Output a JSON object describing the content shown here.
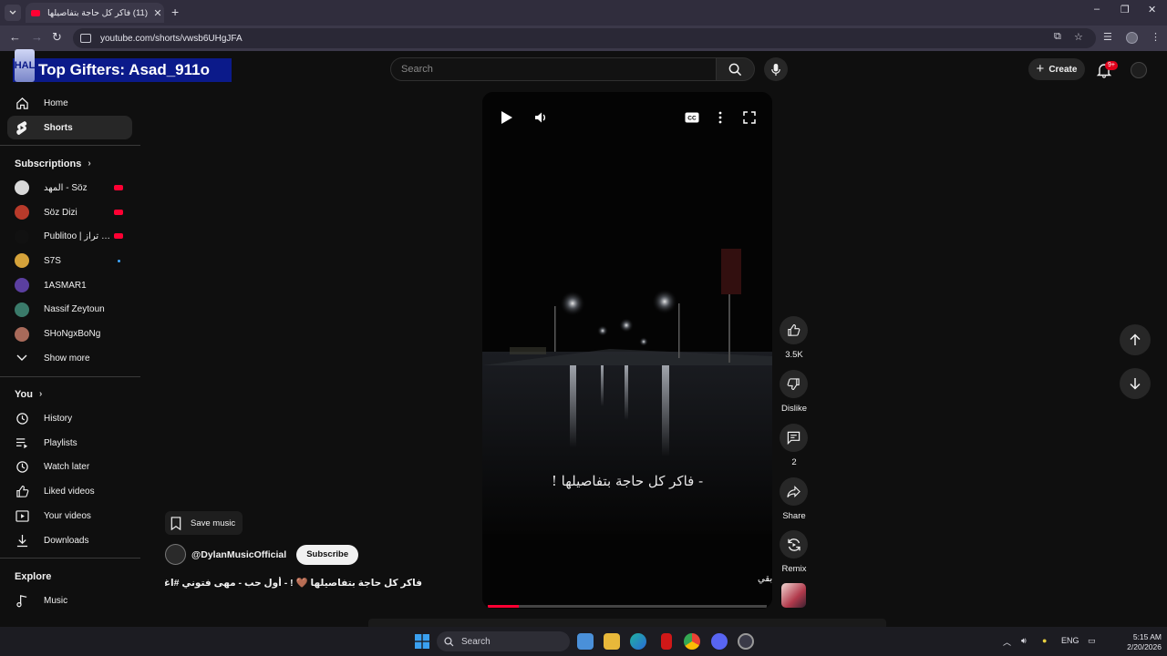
{
  "browser": {
    "tab_title": "(11) فاكر كل حاجة بتفاصيلها 🤎 !",
    "tab_close": "✕",
    "new_tab": "+",
    "url": "youtube.com/shorts/vwsb6UHgJFA",
    "window_controls": [
      "–",
      "❐",
      "✕"
    ]
  },
  "overlay": {
    "logo_text": "HAL",
    "banner_text": "Top Gifters: Asad_911o"
  },
  "header": {
    "search_placeholder": "Search",
    "create_label": "Create",
    "notification_badge": "9+"
  },
  "sidebar": {
    "main": [
      {
        "label": "Home",
        "icon": "home-icon"
      },
      {
        "label": "Shorts",
        "icon": "shorts-icon",
        "active": true
      }
    ],
    "subscriptions_heading": "Subscriptions",
    "subscriptions": [
      {
        "name": "المهد - Söz",
        "color": "#d9d9d9",
        "indicator": "live"
      },
      {
        "name": "Söz Dizi",
        "color": "#b83a2a",
        "indicator": "live"
      },
      {
        "name": "Publitoo | ديلي تراز",
        "color": "#111111",
        "indicator": "live"
      },
      {
        "name": "S7S",
        "color": "#d4a23a",
        "indicator": "new"
      },
      {
        "name": "1ASMAR1",
        "color": "#5b3fa0",
        "indicator": ""
      },
      {
        "name": "Nassif Zeytoun",
        "color": "#3a7a6a",
        "indicator": ""
      },
      {
        "name": "SHoNgxBoNg",
        "color": "#a86a5a",
        "indicator": ""
      }
    ],
    "show_more": "Show more",
    "you_heading": "You",
    "you_items": [
      {
        "label": "History",
        "icon": "history-icon"
      },
      {
        "label": "Playlists",
        "icon": "playlists-icon"
      },
      {
        "label": "Watch later",
        "icon": "watch-later-icon"
      },
      {
        "label": "Liked videos",
        "icon": "liked-videos-icon"
      },
      {
        "label": "Your videos",
        "icon": "your-videos-icon"
      },
      {
        "label": "Downloads",
        "icon": "downloads-icon"
      }
    ],
    "explore_heading": "Explore",
    "explore_items": [
      {
        "label": "Music",
        "icon": "music-icon"
      }
    ],
    "colors": {
      "live": "#ff0033",
      "new": "#3ea6ff"
    }
  },
  "player": {
    "caption": "- فاكر كل حاجة بتفاصيلها !",
    "corner_tag": "[بقي",
    "progress": 0.11
  },
  "actions": {
    "likes": "3.5K",
    "dislike_label": "Dislike",
    "comments": "2",
    "share_label": "Share",
    "remix_label": "Remix"
  },
  "info": {
    "save_music": "Save music",
    "channel": "@DylanMusicOfficial",
    "subscribe": "Subscribe",
    "title": "فاكر كل حاجة بتفاصيلها 🤎 ! - أول حب - مهى فتوني #اغاني ..."
  },
  "taskbar": {
    "search": "Search",
    "lang": "ENG",
    "time": "5:15 AM",
    "date": "2/20/2026"
  }
}
